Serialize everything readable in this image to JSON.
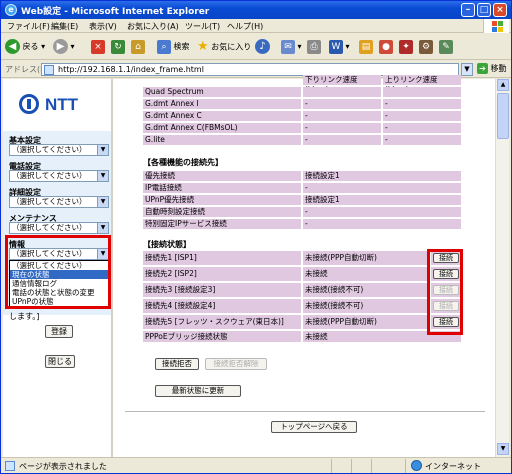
{
  "window": {
    "title": "Web設定 - Microsoft Internet Explorer"
  },
  "menu": [
    "ファイル(F)",
    "編集(E)",
    "表示(V)",
    "お気に入り(A)",
    "ツール(T)",
    "ヘルプ(H)"
  ],
  "toolbar": {
    "back": "戻る",
    "search": "検索",
    "favorites": "お気に入り"
  },
  "address": {
    "label": "アドレス(D)",
    "url": "http://192.168.1.1/index_frame.html",
    "go": "移動"
  },
  "left": {
    "logo": "NTT",
    "menus": [
      {
        "label": "基本設定",
        "value": "（選択してください）"
      },
      {
        "label": "電話設定",
        "value": "（選択してください）"
      },
      {
        "label": "詳細設定",
        "value": "（選択してください）"
      },
      {
        "label": "メンテナンス",
        "value": "（選択してください）"
      },
      {
        "label": "情報",
        "value": "（選択してください）"
      }
    ],
    "dropdown_options": [
      "（選択してください）",
      "現在の状態",
      "通信情報ログ",
      "電話の状態と状態の変更",
      "UPnPの状態"
    ],
    "dropdown_selected_index": 1,
    "note": "します。]",
    "login_button": "登録",
    "close_button": "閉じる"
  },
  "right": {
    "header_cols": [
      "下りリンク速度(kbps)",
      "上りリンク速度(kbps)"
    ],
    "modes": [
      {
        "name": "Quad Spectrum",
        "down": "",
        "up": ""
      },
      {
        "name": "G.dmt Annex I",
        "down": "-",
        "up": "-"
      },
      {
        "name": "G.dmt Annex C",
        "down": "-",
        "up": "-"
      },
      {
        "name": "G.dmt Annex C(FBMsOL)",
        "down": "-",
        "up": "-"
      },
      {
        "name": "G.lite",
        "down": "-",
        "up": "-"
      }
    ],
    "dest_title": "【各種機能の接続先】",
    "dest_rows": [
      {
        "name": "優先接続",
        "value": "接続設定1"
      },
      {
        "name": "IP電話接続",
        "value": "-"
      },
      {
        "name": "UPnP優先接続",
        "value": "接続設定1"
      },
      {
        "name": "自動時刻設定接続",
        "value": "-"
      },
      {
        "name": "特別固定IPサービス接続",
        "value": "-"
      }
    ],
    "conn_title": "【接続状態】",
    "conn_rows": [
      {
        "name": "接続先1 [ISP1]",
        "status": "未接続(PPP自動切断)",
        "button": "接続",
        "enabled": true
      },
      {
        "name": "接続先2 [ISP2]",
        "status": "未接続",
        "button": "接続",
        "enabled": true
      },
      {
        "name": "接続先3 [接続設定3]",
        "status": "未接続(接続不可)",
        "button": "接続",
        "enabled": false
      },
      {
        "name": "接続先4 [接続設定4]",
        "status": "未接続(接続不可)",
        "button": "接続",
        "enabled": false
      },
      {
        "name": "接続先5 [フレッツ・スクウェア(東日本)]",
        "status": "未接続(PPP自動切断)",
        "button": "接続",
        "enabled": true
      }
    ],
    "bridge_row": {
      "name": "PPPoEブリッジ接続状態",
      "status": "未接続"
    },
    "deny_button": "接続拒否",
    "deny_release_button": "接続拒否解除",
    "refresh_button": "最新状態に更新",
    "top_button": "トップページへ戻る"
  },
  "status": {
    "text": "ページが表示されました",
    "zone": "インターネット"
  },
  "colors": {
    "accent": "#316ac5",
    "highlight_box": "#e00000",
    "row_bg": "#e0c8e0"
  }
}
